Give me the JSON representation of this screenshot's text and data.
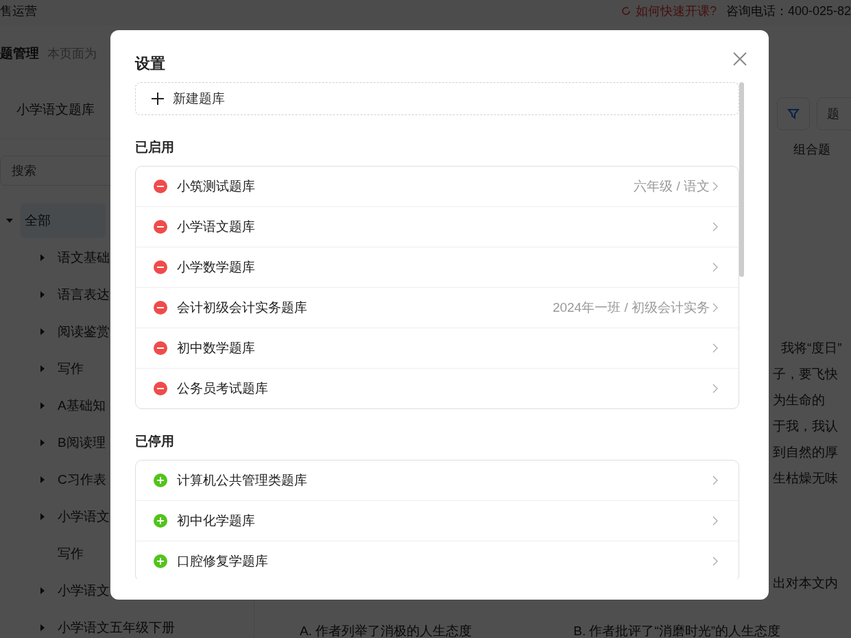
{
  "header": {
    "brand": "售运营",
    "help_link": "如何快速开课?",
    "phone": "咨询电话：400-025-82"
  },
  "page_title": {
    "title": "题管理",
    "description": "本页面为"
  },
  "sidebar": {
    "bank_tab": "小学语文题库",
    "search": {
      "placeholder": "搜索"
    },
    "tree": [
      {
        "label": "全部",
        "selected": true,
        "expanded": true,
        "children": [
          {
            "label": "语文基础",
            "expanded": false,
            "selected": false
          },
          {
            "label": "语言表达",
            "expanded": false,
            "selected": false
          },
          {
            "label": "阅读鉴赏",
            "expanded": false,
            "selected": false
          },
          {
            "label": "写作",
            "expanded": false,
            "selected": false
          },
          {
            "label": "A基础知",
            "expanded": false,
            "selected": false
          },
          {
            "label": "B阅读理",
            "expanded": false,
            "selected": false
          },
          {
            "label": "C习作表",
            "expanded": false,
            "selected": false
          },
          {
            "label": "小学语文",
            "expanded": false,
            "selected": false
          },
          {
            "label": "写作",
            "selected": false
          },
          {
            "label": "小学语文",
            "expanded": false,
            "selected": false
          },
          {
            "label": "小学语文五年级下册",
            "expanded": false,
            "selected": false
          }
        ]
      }
    ]
  },
  "content": {
    "type_filter": {
      "placeholder": "题"
    },
    "question_type": "组合题",
    "passage_lines": [
      "我将“度日”",
      "子，要飞快",
      "为生命的",
      "于我，我认",
      "到自然的厚",
      "生枯燥无味"
    ],
    "question_stem": "出对本文内",
    "options": [
      "A.  作者列举了消极的人生态度",
      "B.  作者批评了“消磨时光”的人生态度"
    ]
  },
  "dialog": {
    "title": "设置",
    "new_button": "新建题库",
    "groups": [
      {
        "title": "已启用",
        "kind": "enabled",
        "items": [
          {
            "name": "小筑测试题库",
            "path": "六年级 / 语文"
          },
          {
            "name": "小学语文题库"
          },
          {
            "name": "小学数学题库"
          },
          {
            "name": "会计初级会计实务题库",
            "path": "2024年一班 / 初级会计实务"
          },
          {
            "name": "初中数学题库"
          },
          {
            "name": "公务员考试题库"
          }
        ]
      },
      {
        "title": "已停用",
        "kind": "disabled",
        "items": [
          {
            "name": "计算机公共管理类题库"
          },
          {
            "name": "初中化学题库"
          },
          {
            "name": "口腔修复学题库"
          }
        ]
      }
    ]
  }
}
